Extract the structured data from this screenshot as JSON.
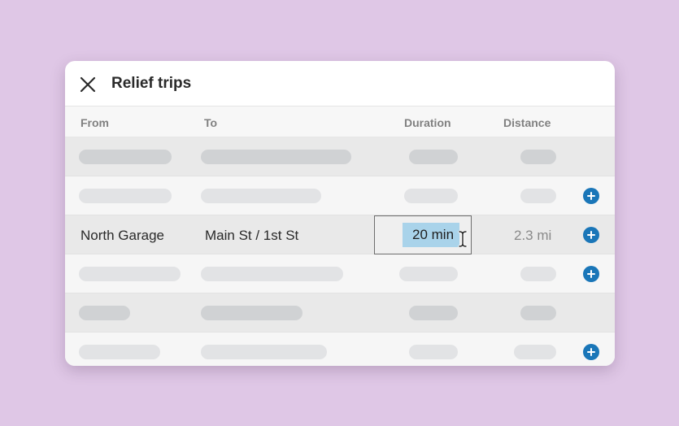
{
  "dialog": {
    "title": "Relief trips",
    "close_icon": "close-icon"
  },
  "table": {
    "columns": [
      "From",
      "To",
      "Duration",
      "Distance"
    ],
    "active_row": {
      "from": "North Garage",
      "to": "Main St / 1st St",
      "duration": "20 min",
      "distance": "2.3 mi"
    }
  },
  "colors": {
    "background": "#dfc7e6",
    "accent": "#1a76b8",
    "selection": "#a9d3ea"
  },
  "icons": {
    "add": "plus-circle-icon",
    "cursor": "text-cursor-icon"
  }
}
